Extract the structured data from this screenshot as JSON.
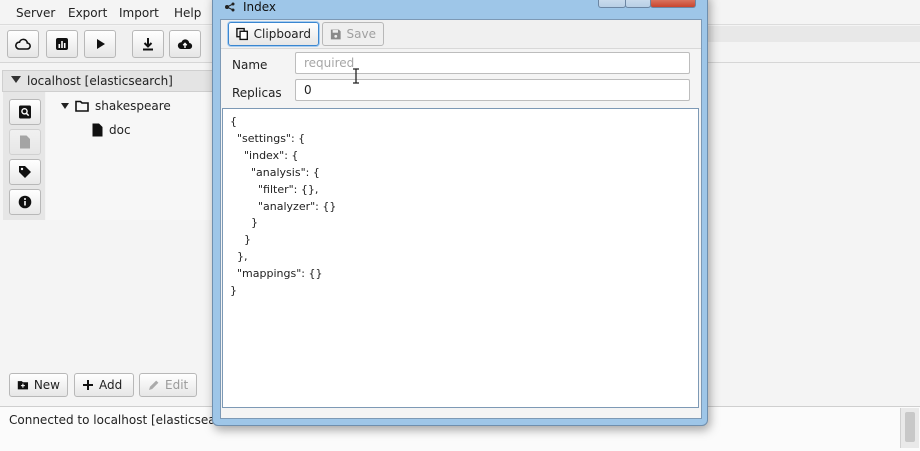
{
  "menu": {
    "items": [
      {
        "label": "Server"
      },
      {
        "label": "Export"
      },
      {
        "label": "Import"
      },
      {
        "label": "Help"
      }
    ]
  },
  "toolbar": {
    "buttons": [
      {
        "name": "cloud-icon"
      },
      {
        "name": "stats-icon"
      },
      {
        "name": "play-icon"
      },
      {
        "name": "download-icon"
      },
      {
        "name": "upload-cloud-icon"
      }
    ]
  },
  "connection": {
    "title": "localhost [elasticsearch]"
  },
  "tree": {
    "root": "shakespeare",
    "child": "doc"
  },
  "bottom_buttons": {
    "new": "New",
    "add": "Add",
    "edit": "Edit"
  },
  "status": {
    "text": "Connected to localhost [elasticsearch]"
  },
  "dialog": {
    "title": "Index",
    "clipboard": "Clipboard",
    "save": "Save",
    "name_label": "Name",
    "name_placeholder": "required",
    "replicas_label": "Replicas",
    "replicas_value": "0",
    "json": "{\n  \"settings\": {\n    \"index\": {\n      \"analysis\": {\n        \"filter\": {},\n        \"analyzer\": {}\n      }\n    }\n  },\n  \"mappings\": {}\n}"
  },
  "colors": {
    "dialog_frame": "#9ec6e8",
    "focus": "#3a86d0"
  }
}
